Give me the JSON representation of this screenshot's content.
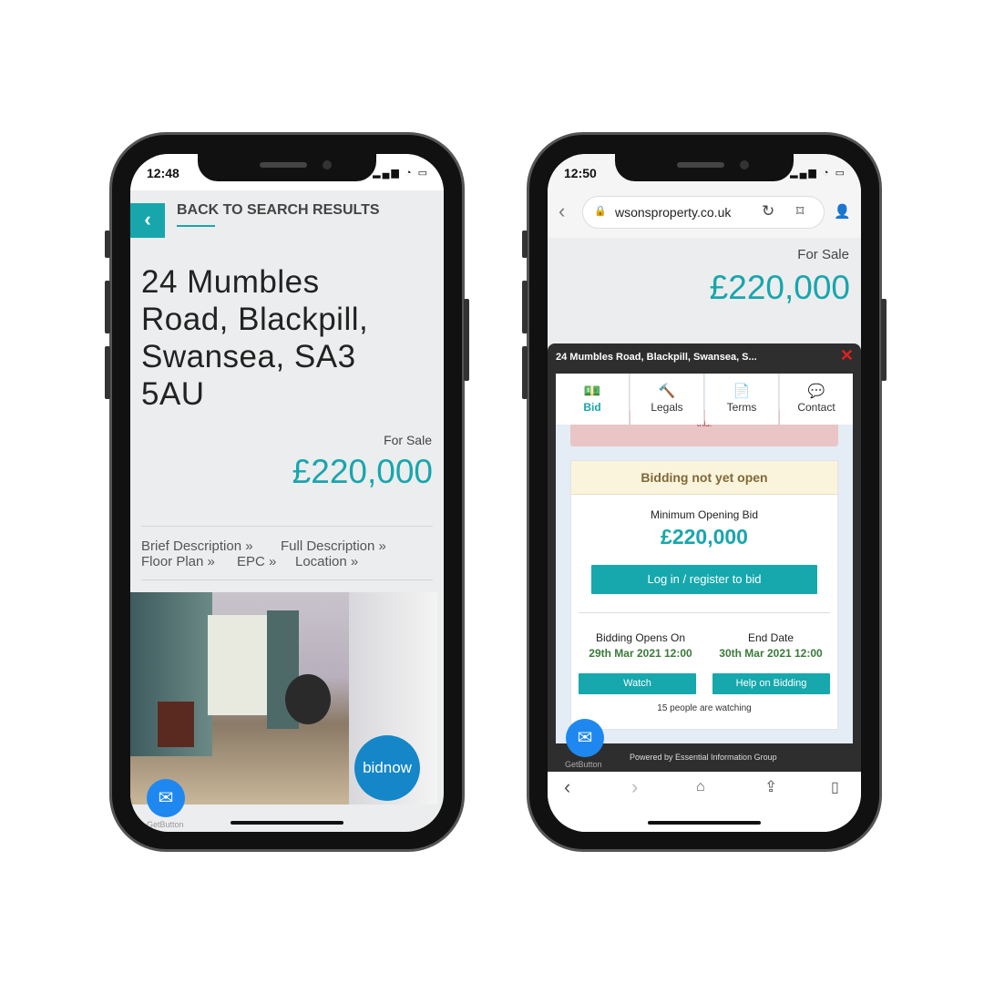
{
  "left_phone": {
    "time": "12:48",
    "back_label": "BACK TO SEARCH RESULTS",
    "title": "24 Mumbles Road, Blackpill, Swansea, SA3 5AU",
    "for_sale": "For Sale",
    "price": "£220,000",
    "links": [
      "Brief Description »",
      "Full Description »",
      "Floor Plan »",
      "EPC »",
      "Location »"
    ],
    "bidnow_a": "bid",
    "bidnow_b": "now",
    "getbutton": "GetButton"
  },
  "right_phone": {
    "time": "12:50",
    "url": "wsonsproperty.co.uk",
    "for_sale": "For Sale",
    "price": "£220,000",
    "modal_title": "24 Mumbles Road, Blackpill, Swansea, S...",
    "tabs": [
      {
        "label": "Bid",
        "icon": "money-icon"
      },
      {
        "label": "Legals",
        "icon": "gavel-icon"
      },
      {
        "label": "Terms",
        "icon": "document-icon"
      },
      {
        "label": "Contact",
        "icon": "chat-icon"
      }
    ],
    "alert_text": "this.",
    "status_banner": "Bidding not yet open",
    "min_bid_label": "Minimum Opening Bid",
    "min_bid": "£220,000",
    "login_button": "Log in / register to bid",
    "opens_label": "Bidding Opens On",
    "opens_value": "29th Mar 2021 12:00",
    "end_label": "End Date",
    "end_value": "30th Mar 2021 12:00",
    "watch_button": "Watch",
    "help_button": "Help on Bidding",
    "watching": "15 people are watching",
    "powered": "Powered by Essential Information Group",
    "getbutton": "GetButton"
  },
  "colors": {
    "accent": "#18a6ad",
    "banner": "#fbf4dc",
    "green": "#3b7a3a",
    "close": "#e02020"
  }
}
